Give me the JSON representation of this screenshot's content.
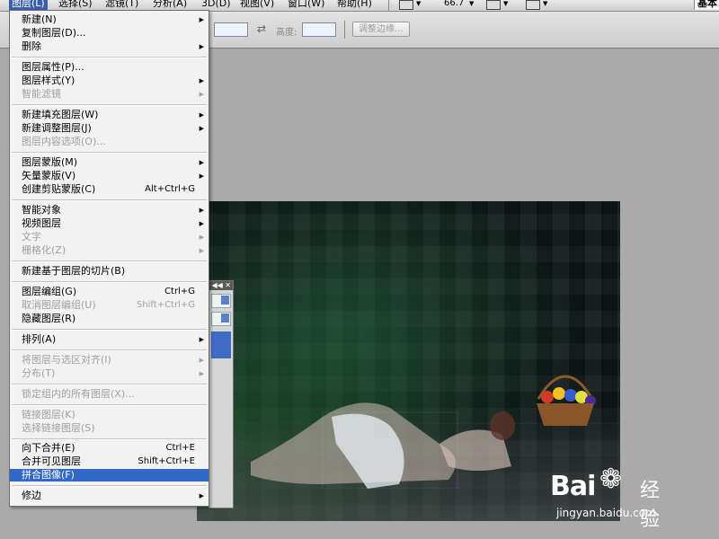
{
  "menubar": {
    "items": [
      "图层(L)",
      "选择(S)",
      "滤镜(T)",
      "分析(A)",
      "3D(D)",
      "视图(V)",
      "窗口(W)",
      "帮助(H)"
    ],
    "zoom": "66.7",
    "workspace": "基本"
  },
  "optbar": {
    "height_label": "高度:",
    "refine_edge": "调整边缘..."
  },
  "panel": {
    "collapse": "◀◀ ✕"
  },
  "menu": {
    "new": "新建(N)",
    "duplicate": "复制图层(D)...",
    "delete": "删除",
    "layer_props": "图层属性(P)...",
    "layer_style": "图层样式(Y)",
    "smart_filter": "智能滤镜",
    "new_fill": "新建填充图层(W)",
    "new_adjust": "新建调整图层(J)",
    "content_opts": "图层内容选项(O)...",
    "layer_mask": "图层蒙版(M)",
    "vector_mask": "矢量蒙版(V)",
    "clip_mask": "创建剪贴蒙版(C)",
    "clip_mask_sc": "Alt+Ctrl+G",
    "smart_obj": "智能对象",
    "video_layer": "视频图层",
    "text": "文字",
    "rasterize": "栅格化(Z)",
    "new_slice": "新建基于图层的切片(B)",
    "group": "图层编组(G)",
    "group_sc": "Ctrl+G",
    "ungroup": "取消图层编组(U)",
    "ungroup_sc": "Shift+Ctrl+G",
    "hide": "隐藏图层(R)",
    "arrange": "排列(A)",
    "align": "将图层与选区对齐(I)",
    "distribute": "分布(T)",
    "lock_all": "锁定组内的所有图层(X)...",
    "link": "链接图层(K)",
    "select_linked": "选择链接图层(S)",
    "merge_down": "向下合并(E)",
    "merge_down_sc": "Ctrl+E",
    "merge_visible": "合并可见图层",
    "merge_visible_sc": "Shift+Ctrl+E",
    "flatten": "拼合图像(F)",
    "matting": "修边"
  },
  "watermark": {
    "brand": "Bai",
    "jingyan": "经验",
    "url": "jingyan.baidu.com"
  }
}
